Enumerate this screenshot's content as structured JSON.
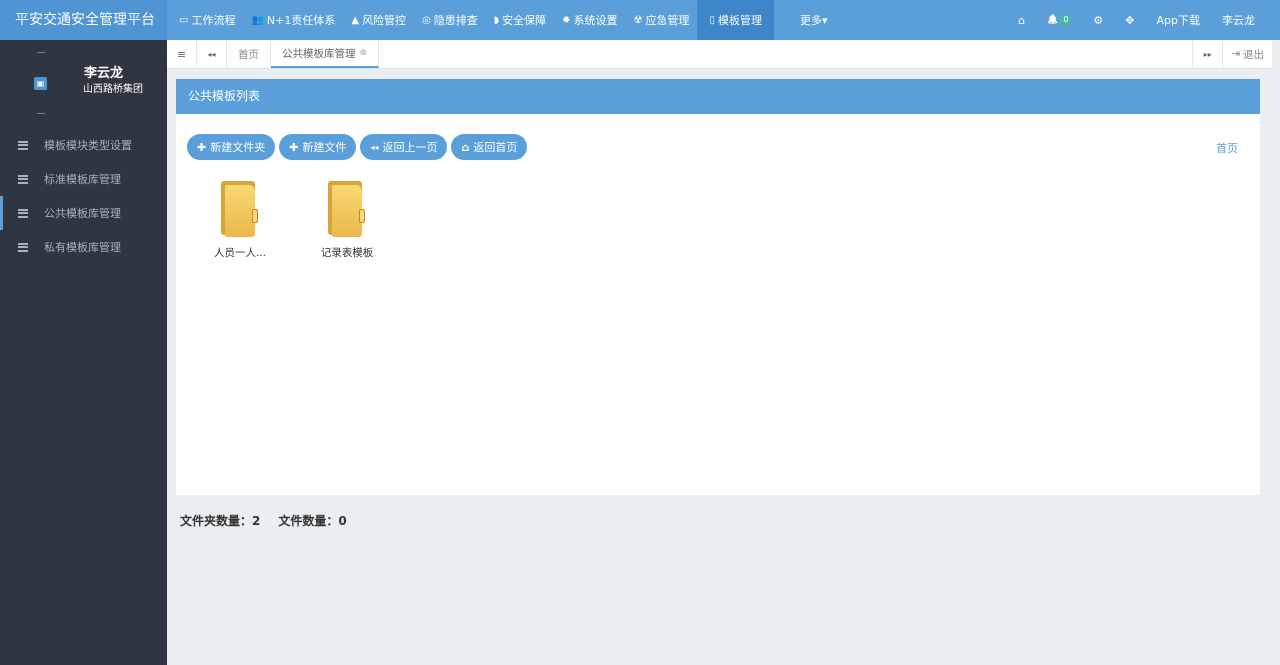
{
  "app_title": "平安交通安全管理平台",
  "nav": [
    {
      "label": "工作流程",
      "icon": "monitor-icon",
      "glyph": "▭"
    },
    {
      "label": "N+1责任体系",
      "icon": "users-icon",
      "glyph": "👥"
    },
    {
      "label": "风险管控",
      "icon": "warning-icon",
      "glyph": "▲"
    },
    {
      "label": "隐患排查",
      "icon": "search-icon",
      "glyph": "◎"
    },
    {
      "label": "安全保障",
      "icon": "shield-icon",
      "glyph": "◗"
    },
    {
      "label": "系统设置",
      "icon": "gear-icon",
      "glyph": "✹"
    },
    {
      "label": "应急管理",
      "icon": "biohazard-icon",
      "glyph": "☢"
    },
    {
      "label": "模板管理",
      "icon": "file-icon",
      "glyph": "▯",
      "active": true
    }
  ],
  "nav_more": "更多▾",
  "nav_right": {
    "home_icon": "⌂",
    "bell_icon": "🔔",
    "notification_count": "0",
    "settings_icon": "⚙",
    "fullscreen_icon": "✥",
    "app_download": "App下载",
    "username": "李云龙"
  },
  "sidebar": {
    "user_name": "李云龙",
    "org": "山西路桥集团",
    "avatar_glyph": "▣",
    "items": [
      {
        "label": "模板模块类型设置"
      },
      {
        "label": "标准模板库管理"
      },
      {
        "label": "公共模板库管理",
        "active": true
      },
      {
        "label": "私有模板库管理"
      }
    ]
  },
  "tabbar": {
    "menu_glyph": "≡",
    "prev_glyph": "◂◂",
    "next_glyph": "▸▸",
    "home_tab": "首页",
    "active_tab": "公共模板库管理",
    "close_glyph": "⊗",
    "logout": "退出",
    "logout_glyph": "⇥"
  },
  "panel": {
    "title": "公共模板列表",
    "buttons": [
      {
        "label": "新建文件夹",
        "glyph": "✚"
      },
      {
        "label": "新建文件",
        "glyph": "✚"
      },
      {
        "label": "返回上一页",
        "glyph": "◂◂"
      },
      {
        "label": "返回首页",
        "glyph": "⌂"
      }
    ],
    "home_link": "首页",
    "folders": [
      {
        "label": "人员一人..."
      },
      {
        "label": "记录表模板"
      }
    ]
  },
  "stats": {
    "folder_count": "文件夹数量：2",
    "file_count": "文件数量：0"
  },
  "colors": {
    "primary": "#5a9fd9",
    "sidebar_bg": "#2f3541",
    "page_bg": "#ebeef0"
  }
}
